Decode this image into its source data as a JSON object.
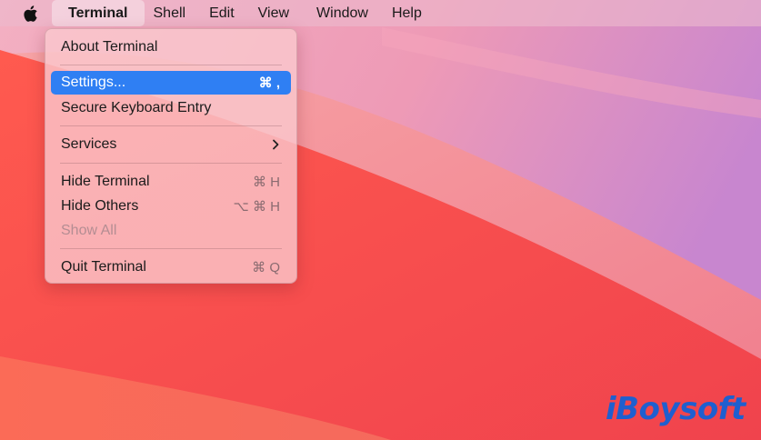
{
  "menubar": {
    "apple_icon": "apple-logo-icon",
    "items": [
      "Terminal",
      "Shell",
      "Edit",
      "View",
      "Window",
      "Help"
    ]
  },
  "menu": {
    "about": "About Terminal",
    "settings": {
      "label": "Settings...",
      "shortcut": "⌘ ,"
    },
    "secure": "Secure Keyboard Entry",
    "services": {
      "label": "Services",
      "arrow": "chevron-right-icon"
    },
    "hide": {
      "label": "Hide Terminal",
      "shortcut": "⌘ H"
    },
    "hide_others": {
      "label": "Hide Others",
      "shortcut": "⌥ ⌘ H"
    },
    "show_all": "Show All",
    "quit": {
      "label": "Quit Terminal",
      "shortcut": "⌘ Q"
    }
  },
  "watermark": "iBoysoft",
  "colors": {
    "highlight": "#2f7ff3",
    "brand": "#1f5fcf"
  }
}
